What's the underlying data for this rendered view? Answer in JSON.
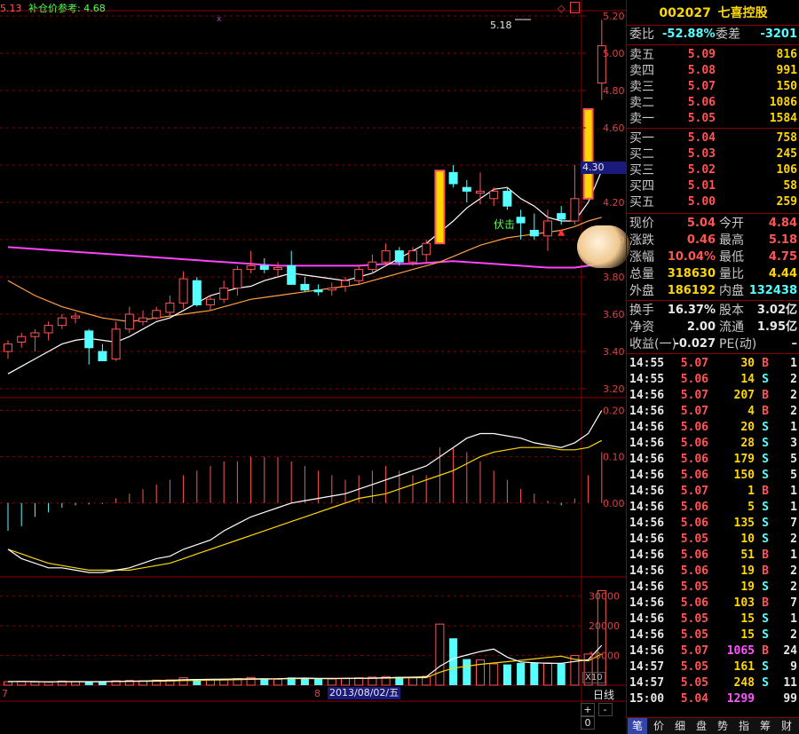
{
  "header": {
    "prev_price": "5.13",
    "refill_label": "补仓价参考: 4.68",
    "high_marker": "5.18"
  },
  "price_axis": [
    "5.20",
    "5.00",
    "4.80",
    "4.60",
    "4.40",
    "4.20",
    "4.00",
    "3.80",
    "3.60",
    "3.40",
    "3.20"
  ],
  "current_price_tag": "4.30",
  "macd_axis": [
    "0.20",
    "0.10",
    "0.00"
  ],
  "volume_axis": [
    "30000",
    "20000",
    "10000"
  ],
  "volume_unit": "X10",
  "date_label": "2013/08/02/五",
  "x_marks": [
    "7",
    "8"
  ],
  "period_label": "日线",
  "zoom_controls": [
    "+",
    "-",
    "0"
  ],
  "annotation": "伏击",
  "stock": {
    "code": "002027",
    "name": "七喜控股"
  },
  "order_ratio": {
    "label1": "委比",
    "value1": "-52.88%",
    "label2": "委差",
    "value2": "-3201"
  },
  "asks": [
    {
      "label": "卖五",
      "price": "5.09",
      "vol": "816"
    },
    {
      "label": "卖四",
      "price": "5.08",
      "vol": "991"
    },
    {
      "label": "卖三",
      "price": "5.07",
      "vol": "150"
    },
    {
      "label": "卖二",
      "price": "5.06",
      "vol": "1086"
    },
    {
      "label": "卖一",
      "price": "5.05",
      "vol": "1584"
    }
  ],
  "bids": [
    {
      "label": "买一",
      "price": "5.04",
      "vol": "758"
    },
    {
      "label": "买二",
      "price": "5.03",
      "vol": "245"
    },
    {
      "label": "买三",
      "price": "5.02",
      "vol": "106"
    },
    {
      "label": "买四",
      "price": "5.01",
      "vol": "58"
    },
    {
      "label": "买五",
      "price": "5.00",
      "vol": "259"
    }
  ],
  "quote": [
    {
      "l1": "现价",
      "v1": "5.04",
      "l2": "今开",
      "v2": "4.84"
    },
    {
      "l1": "涨跌",
      "v1": "0.46",
      "l2": "最高",
      "v2": "5.18"
    },
    {
      "l1": "涨幅",
      "v1": "10.04%",
      "l2": "最低",
      "v2": "4.75"
    },
    {
      "l1": "总量",
      "v1": "318630",
      "l2": "量比",
      "v2": "4.44"
    },
    {
      "l1": "外盘",
      "v1": "186192",
      "l2": "内盘",
      "v2": "132438"
    }
  ],
  "fundamentals": [
    {
      "l1": "换手",
      "v1": "16.37%",
      "l2": "股本",
      "v2": "3.02亿"
    },
    {
      "l1": "净资",
      "v1": "2.00",
      "l2": "流通",
      "v2": "1.95亿"
    },
    {
      "l1": "收益(一)",
      "v1": "-0.027",
      "l2": "PE(动)",
      "v2": "–"
    }
  ],
  "trades": [
    {
      "time": "14:55",
      "price": "5.07",
      "vol": "30",
      "side": "B",
      "cnt": "1"
    },
    {
      "time": "14:55",
      "price": "5.06",
      "vol": "14",
      "side": "S",
      "cnt": "2"
    },
    {
      "time": "14:56",
      "price": "5.07",
      "vol": "207",
      "side": "B",
      "cnt": "2"
    },
    {
      "time": "14:56",
      "price": "5.07",
      "vol": "4",
      "side": "B",
      "cnt": "2"
    },
    {
      "time": "14:56",
      "price": "5.06",
      "vol": "20",
      "side": "S",
      "cnt": "1"
    },
    {
      "time": "14:56",
      "price": "5.06",
      "vol": "28",
      "side": "S",
      "cnt": "3"
    },
    {
      "time": "14:56",
      "price": "5.06",
      "vol": "179",
      "side": "S",
      "cnt": "5"
    },
    {
      "time": "14:56",
      "price": "5.06",
      "vol": "150",
      "side": "S",
      "cnt": "5"
    },
    {
      "time": "14:56",
      "price": "5.07",
      "vol": "1",
      "side": "B",
      "cnt": "1"
    },
    {
      "time": "14:56",
      "price": "5.06",
      "vol": "5",
      "side": "S",
      "cnt": "1"
    },
    {
      "time": "14:56",
      "price": "5.06",
      "vol": "135",
      "side": "S",
      "cnt": "7"
    },
    {
      "time": "14:56",
      "price": "5.05",
      "vol": "10",
      "side": "S",
      "cnt": "2"
    },
    {
      "time": "14:56",
      "price": "5.06",
      "vol": "51",
      "side": "B",
      "cnt": "1"
    },
    {
      "time": "14:56",
      "price": "5.06",
      "vol": "19",
      "side": "B",
      "cnt": "2"
    },
    {
      "time": "14:56",
      "price": "5.05",
      "vol": "19",
      "side": "S",
      "cnt": "2"
    },
    {
      "time": "14:56",
      "price": "5.06",
      "vol": "103",
      "side": "B",
      "cnt": "7"
    },
    {
      "time": "14:56",
      "price": "5.05",
      "vol": "15",
      "side": "S",
      "cnt": "1"
    },
    {
      "time": "14:56",
      "price": "5.05",
      "vol": "15",
      "side": "S",
      "cnt": "2"
    },
    {
      "time": "14:56",
      "price": "5.07",
      "vol": "1065",
      "side": "B",
      "cnt": "24"
    },
    {
      "time": "14:57",
      "price": "5.05",
      "vol": "161",
      "side": "S",
      "cnt": "9"
    },
    {
      "time": "14:57",
      "price": "5.05",
      "vol": "248",
      "side": "S",
      "cnt": "11"
    },
    {
      "time": "15:00",
      "price": "5.04",
      "vol": "1299",
      "side": "",
      "cnt": "99"
    }
  ],
  "tabs": [
    "笔",
    "价",
    "细",
    "盘",
    "势",
    "指",
    "筹",
    "财"
  ],
  "colors": {
    "up": "#ff5555",
    "down": "#55ffff",
    "ma5": "#ffffff",
    "ma10": "#ffd700",
    "ma20": "#ffa040",
    "ma60": "#ff44ff",
    "grid": "#8b0000"
  },
  "chart_data": {
    "type": "candlestick",
    "price_ylim": [
      3.2,
      5.2
    ],
    "candles": [
      {
        "o": 3.4,
        "h": 3.46,
        "l": 3.36,
        "c": 3.44
      },
      {
        "o": 3.45,
        "h": 3.5,
        "l": 3.42,
        "c": 3.48
      },
      {
        "o": 3.48,
        "h": 3.52,
        "l": 3.4,
        "c": 3.5
      },
      {
        "o": 3.5,
        "h": 3.56,
        "l": 3.46,
        "c": 3.54
      },
      {
        "o": 3.54,
        "h": 3.6,
        "l": 3.52,
        "c": 3.58
      },
      {
        "o": 3.58,
        "h": 3.61,
        "l": 3.55,
        "c": 3.59
      },
      {
        "o": 3.51,
        "h": 3.52,
        "l": 3.33,
        "c": 3.42
      },
      {
        "o": 3.4,
        "h": 3.44,
        "l": 3.36,
        "c": 3.35
      },
      {
        "o": 3.36,
        "h": 3.56,
        "l": 3.35,
        "c": 3.52
      },
      {
        "o": 3.52,
        "h": 3.64,
        "l": 3.5,
        "c": 3.6
      },
      {
        "o": 3.56,
        "h": 3.62,
        "l": 3.54,
        "c": 3.58
      },
      {
        "o": 3.58,
        "h": 3.64,
        "l": 3.57,
        "c": 3.62
      },
      {
        "o": 3.61,
        "h": 3.7,
        "l": 3.59,
        "c": 3.66
      },
      {
        "o": 3.66,
        "h": 3.83,
        "l": 3.63,
        "c": 3.79
      },
      {
        "o": 3.78,
        "h": 3.8,
        "l": 3.64,
        "c": 3.65
      },
      {
        "o": 3.65,
        "h": 3.7,
        "l": 3.62,
        "c": 3.68
      },
      {
        "o": 3.68,
        "h": 3.78,
        "l": 3.66,
        "c": 3.74
      },
      {
        "o": 3.74,
        "h": 3.86,
        "l": 3.7,
        "c": 3.84
      },
      {
        "o": 3.84,
        "h": 3.94,
        "l": 3.82,
        "c": 3.86
      },
      {
        "o": 3.86,
        "h": 3.9,
        "l": 3.82,
        "c": 3.84
      },
      {
        "o": 3.84,
        "h": 3.88,
        "l": 3.8,
        "c": 3.85
      },
      {
        "o": 3.86,
        "h": 3.94,
        "l": 3.8,
        "c": 3.76
      },
      {
        "o": 3.76,
        "h": 3.8,
        "l": 3.72,
        "c": 3.73
      },
      {
        "o": 3.73,
        "h": 3.76,
        "l": 3.7,
        "c": 3.72
      },
      {
        "o": 3.73,
        "h": 3.77,
        "l": 3.7,
        "c": 3.74
      },
      {
        "o": 3.75,
        "h": 3.8,
        "l": 3.72,
        "c": 3.78
      },
      {
        "o": 3.78,
        "h": 3.86,
        "l": 3.76,
        "c": 3.84
      },
      {
        "o": 3.84,
        "h": 3.92,
        "l": 3.82,
        "c": 3.88
      },
      {
        "o": 3.88,
        "h": 3.98,
        "l": 3.86,
        "c": 3.94
      },
      {
        "o": 3.94,
        "h": 3.96,
        "l": 3.86,
        "c": 3.88
      },
      {
        "o": 3.88,
        "h": 3.96,
        "l": 3.86,
        "c": 3.94
      },
      {
        "o": 3.92,
        "h": 4.0,
        "l": 3.88,
        "c": 3.98
      },
      {
        "o": 3.98,
        "h": 4.37,
        "l": 3.98,
        "c": 4.37
      },
      {
        "o": 4.36,
        "h": 4.4,
        "l": 4.28,
        "c": 4.3
      },
      {
        "o": 4.28,
        "h": 4.32,
        "l": 4.2,
        "c": 4.26
      },
      {
        "o": 4.25,
        "h": 4.36,
        "l": 4.19,
        "c": 4.26
      },
      {
        "o": 4.22,
        "h": 4.28,
        "l": 4.18,
        "c": 4.26
      },
      {
        "o": 4.26,
        "h": 4.28,
        "l": 4.16,
        "c": 4.18
      },
      {
        "o": 4.12,
        "h": 4.16,
        "l": 4.0,
        "c": 4.09
      },
      {
        "o": 4.05,
        "h": 4.14,
        "l": 4.0,
        "c": 4.02
      },
      {
        "o": 4.02,
        "h": 4.16,
        "l": 3.94,
        "c": 4.1
      },
      {
        "o": 4.14,
        "h": 4.18,
        "l": 4.08,
        "c": 4.11
      },
      {
        "o": 4.1,
        "h": 4.4,
        "l": 4.08,
        "c": 4.22
      },
      {
        "o": 4.22,
        "h": 4.7,
        "l": 4.22,
        "c": 4.7
      },
      {
        "o": 4.84,
        "h": 5.18,
        "l": 4.75,
        "c": 5.04
      }
    ],
    "limit_up_bars": [
      32,
      43
    ],
    "ma5": [
      3.28,
      3.32,
      3.36,
      3.4,
      3.44,
      3.46,
      3.47,
      3.46,
      3.45,
      3.48,
      3.52,
      3.56,
      3.58,
      3.62,
      3.66,
      3.7,
      3.72,
      3.74,
      3.75,
      3.78,
      3.8,
      3.82,
      3.81,
      3.8,
      3.79,
      3.78,
      3.8,
      3.82,
      3.86,
      3.9,
      3.94,
      3.98,
      4.04,
      4.1,
      4.17,
      4.22,
      4.27,
      4.28,
      4.22,
      4.18,
      4.12,
      4.1,
      4.1,
      4.2,
      4.37
    ],
    "ma10": [
      3.78,
      3.74,
      3.7,
      3.67,
      3.64,
      3.62,
      3.6,
      3.58,
      3.57,
      3.56,
      3.57,
      3.58,
      3.59,
      3.6,
      3.61,
      3.62,
      3.64,
      3.66,
      3.68,
      3.69,
      3.7,
      3.71,
      3.72,
      3.73,
      3.74,
      3.75,
      3.76,
      3.78,
      3.8,
      3.82,
      3.84,
      3.86,
      3.88,
      3.91,
      3.94,
      3.97,
      3.99,
      4.01,
      4.02,
      4.03,
      4.04,
      4.05,
      4.07,
      4.1,
      4.12
    ],
    "ma60": [
      3.96,
      3.955,
      3.95,
      3.945,
      3.94,
      3.935,
      3.93,
      3.925,
      3.92,
      3.915,
      3.91,
      3.905,
      3.9,
      3.895,
      3.89,
      3.885,
      3.88,
      3.875,
      3.87,
      3.865,
      3.86,
      3.86,
      3.86,
      3.86,
      3.86,
      3.86,
      3.86,
      3.865,
      3.87,
      3.87,
      3.87,
      3.875,
      3.88,
      3.885,
      3.88,
      3.875,
      3.87,
      3.865,
      3.86,
      3.855,
      3.85,
      3.85,
      3.85,
      3.86,
      3.875
    ],
    "macd_ylim": [
      -0.15,
      0.22
    ],
    "macd_hist": [
      -0.06,
      -0.05,
      -0.03,
      -0.02,
      -0.01,
      -0.005,
      -0.003,
      -0.002,
      0.01,
      0.02,
      0.03,
      0.04,
      0.05,
      0.06,
      0.07,
      0.08,
      0.09,
      0.09,
      0.1,
      0.1,
      0.1,
      0.09,
      0.08,
      0.07,
      0.06,
      0.05,
      0.06,
      0.07,
      0.08,
      0.07,
      0.06,
      0.06,
      0.12,
      0.12,
      0.11,
      0.09,
      0.07,
      0.05,
      0.03,
      0.02,
      0.005,
      -0.005,
      0.01,
      0.06,
      0.11
    ],
    "macd_dif": [
      -0.1,
      -0.12,
      -0.13,
      -0.14,
      -0.14,
      -0.145,
      -0.15,
      -0.15,
      -0.145,
      -0.14,
      -0.13,
      -0.12,
      -0.115,
      -0.1,
      -0.09,
      -0.08,
      -0.06,
      -0.045,
      -0.03,
      -0.02,
      -0.01,
      0.0,
      0.005,
      0.01,
      0.015,
      0.02,
      0.03,
      0.04,
      0.05,
      0.06,
      0.07,
      0.08,
      0.1,
      0.12,
      0.14,
      0.15,
      0.15,
      0.145,
      0.14,
      0.13,
      0.125,
      0.12,
      0.13,
      0.15,
      0.2
    ],
    "macd_dea": [
      -0.1,
      -0.11,
      -0.12,
      -0.13,
      -0.135,
      -0.14,
      -0.145,
      -0.145,
      -0.145,
      -0.145,
      -0.14,
      -0.135,
      -0.13,
      -0.12,
      -0.11,
      -0.1,
      -0.09,
      -0.08,
      -0.07,
      -0.06,
      -0.05,
      -0.04,
      -0.03,
      -0.02,
      -0.01,
      0.0,
      0.01,
      0.015,
      0.02,
      0.03,
      0.04,
      0.05,
      0.06,
      0.07,
      0.085,
      0.1,
      0.11,
      0.115,
      0.12,
      0.12,
      0.12,
      0.115,
      0.115,
      0.12,
      0.135
    ],
    "volume_ylim": [
      0,
      35000
    ],
    "volume": [
      1200,
      1300,
      1100,
      1000,
      1400,
      1200,
      1100,
      1300,
      1500,
      1600,
      1500,
      1700,
      1800,
      2500,
      2100,
      1900,
      1800,
      2200,
      2600,
      2300,
      2000,
      2600,
      2400,
      2200,
      2100,
      2300,
      2500,
      2700,
      2900,
      2800,
      2600,
      3000,
      20600,
      15800,
      8800,
      8500,
      7200,
      7000,
      7500,
      7600,
      7500,
      7300,
      10000,
      10500,
      31900
    ]
  }
}
